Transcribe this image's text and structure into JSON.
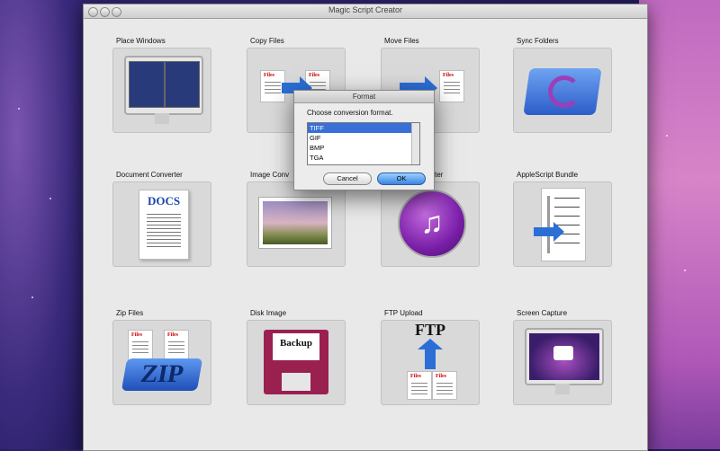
{
  "window": {
    "title": "Magic Script Creator"
  },
  "tiles": [
    {
      "label": "Place Windows"
    },
    {
      "label": "Copy Files"
    },
    {
      "label": "Move Files"
    },
    {
      "label": "Sync Folders"
    },
    {
      "label": "Document Converter"
    },
    {
      "label": "Image Conv"
    },
    {
      "label": "ter"
    },
    {
      "label": "AppleScript Bundle"
    },
    {
      "label": "Zip Files"
    },
    {
      "label": "Disk Image"
    },
    {
      "label": "FTP Upload"
    },
    {
      "label": "Screen Capture"
    }
  ],
  "icon_text": {
    "files": "Files",
    "docs": "DOCS",
    "zip": "ZIP",
    "backup": "Backup",
    "ftp": "FTP"
  },
  "dialog": {
    "title": "Format",
    "prompt": "Choose conversion format.",
    "options": [
      "TIFF",
      "GIF",
      "BMP",
      "TGA"
    ],
    "selected": "TIFF",
    "cancel_label": "Cancel",
    "ok_label": "OK"
  }
}
